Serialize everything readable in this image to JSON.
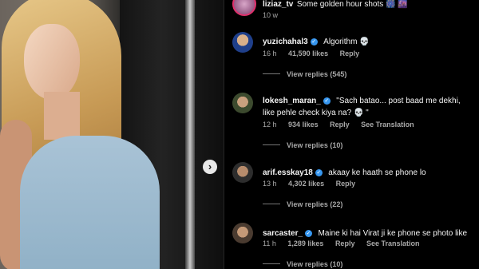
{
  "top_comment": {
    "username": "liziaz_tv",
    "text": "Some golden hour shots 🎆 🌆",
    "time": "10 w"
  },
  "comments": [
    {
      "username": "yuzichahal3",
      "verified": true,
      "text": "Algorithm 💀",
      "time": "16 h",
      "likes": "41,590 likes",
      "reply": "Reply",
      "translation": "",
      "view_replies": "View replies (545)"
    },
    {
      "username": "lokesh_maran_",
      "verified": true,
      "text": "\"Sach batao... post baad me dekhi, like pehle check kiya na? 💀 \"",
      "time": "12 h",
      "likes": "934 likes",
      "reply": "Reply",
      "translation": "See Translation",
      "view_replies": "View replies (10)"
    },
    {
      "username": "arif.esskay18",
      "verified": true,
      "text": "akaay ke haath se phone lo",
      "time": "13 h",
      "likes": "4,302 likes",
      "reply": "Reply",
      "translation": "",
      "view_replies": "View replies (22)"
    },
    {
      "username": "sarcaster_",
      "verified": true,
      "text": "Maine ki hai Virat ji ke phone se photo like",
      "time": "11 h",
      "likes": "1,289 likes",
      "reply": "Reply",
      "translation": "See Translation",
      "view_replies": "View replies (10)"
    }
  ],
  "icons": {
    "next": "chevron-right-icon",
    "verified": "verified-badge-icon"
  }
}
